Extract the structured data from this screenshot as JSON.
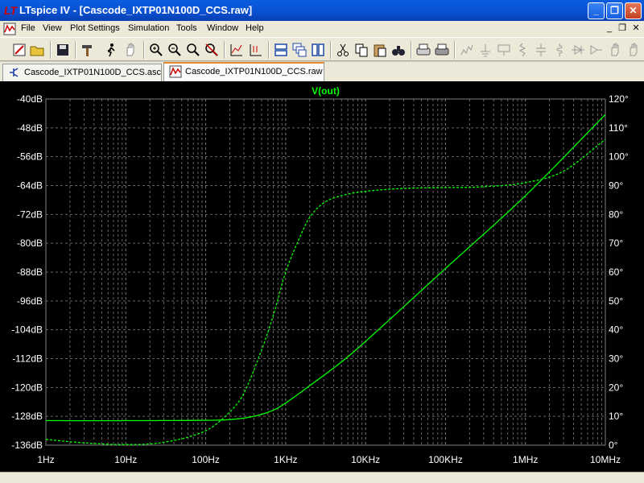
{
  "window": {
    "title": "LTspice IV - [Cascode_IXTP01N100D_CCS.raw]",
    "minimize": "_",
    "maximize": "❐",
    "close": "✕"
  },
  "menu": {
    "items": [
      "File",
      "View",
      "Plot Settings",
      "Simulation",
      "Tools",
      "Window",
      "Help"
    ],
    "mdi_minimize": "_",
    "mdi_restore": "❐",
    "mdi_close": "✕"
  },
  "tabs": [
    {
      "label": "Cascode_IXTP01N100D_CCS.asc",
      "icon": "schematic-icon"
    },
    {
      "label": "Cascode_IXTP01N100D_CCS.raw",
      "icon": "waveform-icon",
      "active": true
    }
  ],
  "toolbar": {
    "buttons": [
      "run-icon",
      "open-icon",
      "save-icon",
      "hammer-icon",
      "run-man-icon",
      "hand-icon",
      "zoom-in-icon",
      "zoom-out-icon",
      "zoom-fit-icon",
      "zoom-cancel-icon",
      "autorange-icon",
      "probe-icon",
      "tile-horizontal-icon",
      "cascade-icon",
      "tile-vertical-icon",
      "cut-icon",
      "copy-icon",
      "paste-icon",
      "find-icon",
      "print-preview-icon",
      "print-icon",
      "resistor-icon",
      "ground-icon",
      "label-icon",
      "capacitor-icon",
      "inductor-icon",
      "diode-icon",
      "component-icon",
      "move-icon",
      "drag-icon"
    ]
  },
  "colors": {
    "trace": "#00ff00",
    "grid_minor": "#666666",
    "grid_major": "#808080",
    "plot_bg": "#000000",
    "axis_text": "#ffffff"
  },
  "chart_data": {
    "type": "line",
    "title": "V(out)",
    "x_scale": "log",
    "xlim": [
      1,
      10000000
    ],
    "x_ticks": [
      "1Hz",
      "10Hz",
      "100Hz",
      "1KHz",
      "10KHz",
      "100KHz",
      "1MHz",
      "10MHz"
    ],
    "y_left_ticks": [
      "-40dB",
      "-48dB",
      "-56dB",
      "-64dB",
      "-72dB",
      "-80dB",
      "-88dB",
      "-96dB",
      "-104dB",
      "-112dB",
      "-120dB",
      "-128dB",
      "-136dB"
    ],
    "y_left_lim": [
      -136,
      -40
    ],
    "y_right_ticks": [
      "120°",
      "110°",
      "100°",
      "90°",
      "80°",
      "70°",
      "60°",
      "50°",
      "40°",
      "30°",
      "20°",
      "10°",
      "0°"
    ],
    "y_right_lim": [
      0,
      120
    ],
    "grid": true,
    "series": [
      {
        "name": "V(out)",
        "style": "solid",
        "axis": "left",
        "x": [
          1,
          10,
          100,
          200,
          400,
          700,
          1000,
          2000,
          5000,
          10000,
          100000,
          1000000,
          10000000
        ],
        "y": [
          -129.2,
          -129.2,
          -129.1,
          -128.9,
          -128.0,
          -126.3,
          -124.3,
          -119.5,
          -112.9,
          -107.2,
          -87.0,
          -66.8,
          -44.3
        ]
      },
      {
        "name": "phase",
        "style": "dashed",
        "axis": "right",
        "x": [
          1,
          3,
          10,
          30,
          100,
          200,
          300,
          500,
          700,
          1000,
          1500,
          2000,
          3000,
          5000,
          10000,
          30000,
          100000,
          300000,
          1000000,
          3000000,
          10000000
        ],
        "y": [
          2.0,
          0.8,
          0.2,
          1.0,
          5.0,
          11.5,
          18.0,
          33.0,
          45.0,
          60.0,
          72.0,
          79.0,
          84.0,
          86.5,
          88.0,
          89.0,
          89.3,
          89.6,
          91.0,
          95.0,
          106.0
        ]
      }
    ]
  }
}
